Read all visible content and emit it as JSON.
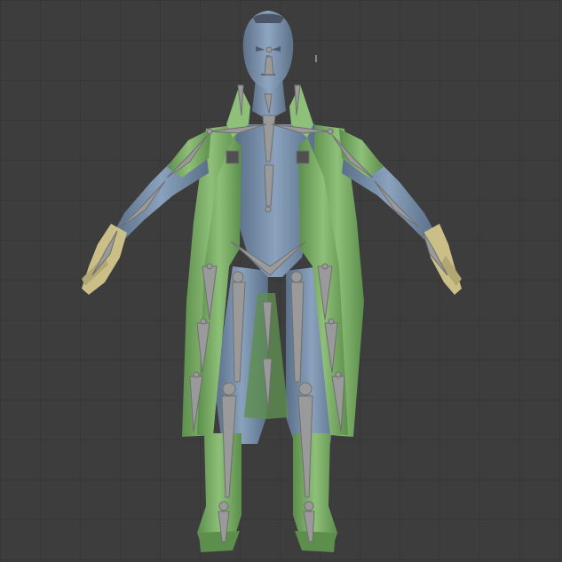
{
  "viewport": {
    "background_color": "#3d3d3d",
    "grid_color": "#353535"
  },
  "model": {
    "body_color": "#7d95b0",
    "body_shadow": "#566a82",
    "coat_color": "#86b872",
    "coat_shadow": "#5a8a4c",
    "glove_color": "#cbbf88",
    "bone_color": "#9a9a9a",
    "bone_dark": "#6f6f6f",
    "icons": [
      "character-model-icon",
      "armature-bones-icon"
    ]
  }
}
